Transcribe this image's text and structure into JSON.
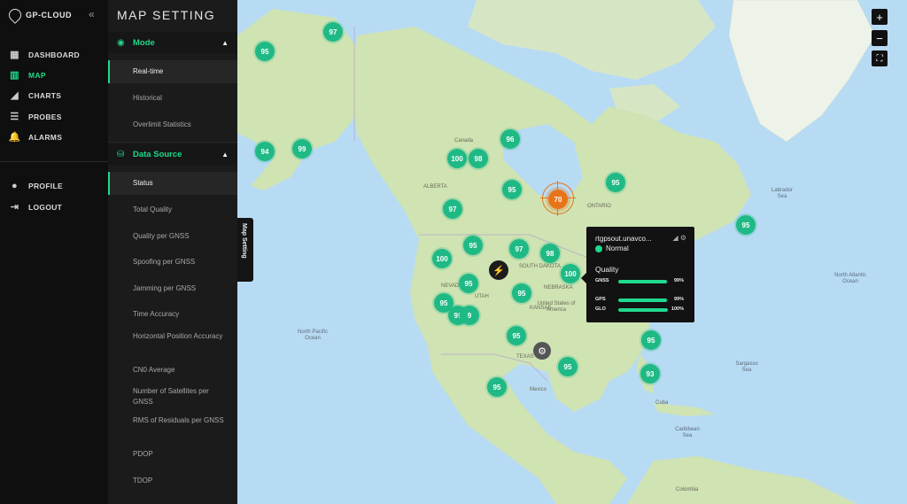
{
  "app": {
    "logo_text": "GP-CLOUD"
  },
  "nav": {
    "items": [
      {
        "label": "DASHBOARD",
        "icon": "grid-icon",
        "glyph": "▦"
      },
      {
        "label": "MAP",
        "icon": "map-icon",
        "glyph": "▥"
      },
      {
        "label": "CHARTS",
        "icon": "chart-icon",
        "glyph": "◢"
      },
      {
        "label": "PROBES",
        "icon": "list-icon",
        "glyph": "☰"
      },
      {
        "label": "ALARMS",
        "icon": "bell-icon",
        "glyph": "🔔"
      }
    ],
    "bottom": [
      {
        "label": "PROFILE",
        "icon": "user-icon",
        "glyph": "●"
      },
      {
        "label": "LOGOUT",
        "icon": "logout-icon",
        "glyph": "⇥"
      }
    ],
    "active": "MAP"
  },
  "panel": {
    "title": "MAP SETTING",
    "tab_label": "Map Setting",
    "mode": {
      "title": "Mode",
      "options": [
        "Real-time",
        "Historical",
        "Overlimit Statistics"
      ],
      "selected": "Real-time"
    },
    "data_source": {
      "title": "Data Source",
      "options": [
        "Status",
        "Total Quality",
        "Quality per GNSS",
        "Spoofing per GNSS",
        "Jamming per GNSS",
        "Time Accuracy",
        "Horizontal Position Accuracy",
        "CN0 Average",
        "Number of Satellites per GNSS",
        "RMS of Residuals per GNSS",
        "PDOP",
        "TDOP"
      ],
      "selected": "Status"
    }
  },
  "map": {
    "controls": {
      "zoom_in": "+",
      "zoom_out": "−",
      "fullscreen": "⛶"
    },
    "labels": [
      {
        "text": "Canada",
        "kind": "land"
      },
      {
        "text": "United States of America",
        "kind": "land"
      },
      {
        "text": "Mexico",
        "kind": "land"
      },
      {
        "text": "Cuba",
        "kind": "land"
      },
      {
        "text": "Colombia",
        "kind": "land"
      },
      {
        "text": "Labrador Sea",
        "kind": "water"
      },
      {
        "text": "North Pacific Ocean",
        "kind": "water"
      },
      {
        "text": "North Atlantic Ocean",
        "kind": "water"
      },
      {
        "text": "Sargasso Sea",
        "kind": "water"
      },
      {
        "text": "Caribbean Sea",
        "kind": "water"
      },
      {
        "text": "NEBRASKA",
        "kind": "land"
      },
      {
        "text": "KANSAS",
        "kind": "land"
      },
      {
        "text": "TEXAS",
        "kind": "land"
      },
      {
        "text": "NEVADA",
        "kind": "land"
      },
      {
        "text": "UTAH",
        "kind": "land"
      },
      {
        "text": "SOUTH DAKOTA",
        "kind": "land"
      },
      {
        "text": "ONTARIO",
        "kind": "land"
      },
      {
        "text": "ALBERTA",
        "kind": "land"
      }
    ],
    "markers": [
      "97",
      "95",
      "94",
      "99",
      "100",
      "98",
      "96",
      "95",
      "95",
      "97",
      "95",
      "97",
      "98",
      "100",
      "100",
      "95",
      "95",
      "95",
      "99",
      "9",
      "95",
      "95",
      "95",
      "95",
      "93",
      "95"
    ],
    "alert_marker": "70"
  },
  "popup": {
    "host": "rtgpsout.unavco...",
    "status": "Normal",
    "quality_title": "Quality",
    "rows": [
      {
        "name": "GNSS",
        "value": "99%",
        "level": 0.99
      },
      {
        "name": "GPS",
        "value": "99%",
        "level": 0.99
      },
      {
        "name": "GLO",
        "value": "100%",
        "level": 1.0
      }
    ]
  },
  "colors": {
    "accent": "#1ed98a",
    "marker": "#1fb985",
    "alert": "#e8741a",
    "water": "#b8dbf4",
    "land": "#cfe3b3"
  }
}
